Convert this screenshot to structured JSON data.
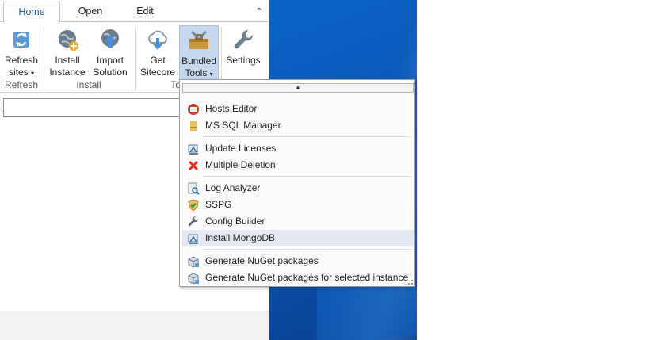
{
  "tabs": [
    {
      "label": "Home"
    },
    {
      "label": "Open"
    },
    {
      "label": "Edit"
    }
  ],
  "ribbon": {
    "buttons": [
      {
        "line1": "Refresh",
        "line2": "sites",
        "icon": "refresh-icon"
      },
      {
        "line1": "Install",
        "line2": "Instance",
        "icon": "install-globe-icon"
      },
      {
        "line1": "Import",
        "line2": "Solution",
        "icon": "import-globe-icon"
      },
      {
        "line1": "Get",
        "line2": "Sitecore",
        "icon": "cloud-download-icon"
      },
      {
        "line1": "Bundled",
        "line2": "Tools",
        "icon": "toolbox-icon"
      },
      {
        "line1": "Settings",
        "line2": "",
        "icon": "wrench-icon"
      }
    ],
    "groups": [
      {
        "label": "Refresh"
      },
      {
        "label": "Install"
      },
      {
        "label": "Too"
      }
    ]
  },
  "search": {
    "value": ""
  },
  "menu": {
    "items": [
      {
        "label": "Hosts Editor",
        "icon": "hosts-editor-icon"
      },
      {
        "label": "MS SQL Manager",
        "icon": "database-icon"
      },
      {
        "label": "Update Licenses",
        "icon": "update-licenses-icon"
      },
      {
        "label": "Multiple Deletion",
        "icon": "red-x-icon"
      },
      {
        "label": "Log Analyzer",
        "icon": "log-analyzer-icon"
      },
      {
        "label": "SSPG",
        "icon": "shield-icon"
      },
      {
        "label": "Config Builder",
        "icon": "wrench-icon"
      },
      {
        "label": "Install MongoDB",
        "icon": "install-mongodb-icon"
      },
      {
        "label": "Generate NuGet packages",
        "icon": "package-icon"
      },
      {
        "label": "Generate NuGet packages for selected instance",
        "icon": "package-icon"
      }
    ]
  },
  "colors": {
    "accent": "#2b579a",
    "pressed": "#c5d8ee",
    "menu_highlight": "#e4e8f0",
    "desktop": "#0a56b4"
  }
}
